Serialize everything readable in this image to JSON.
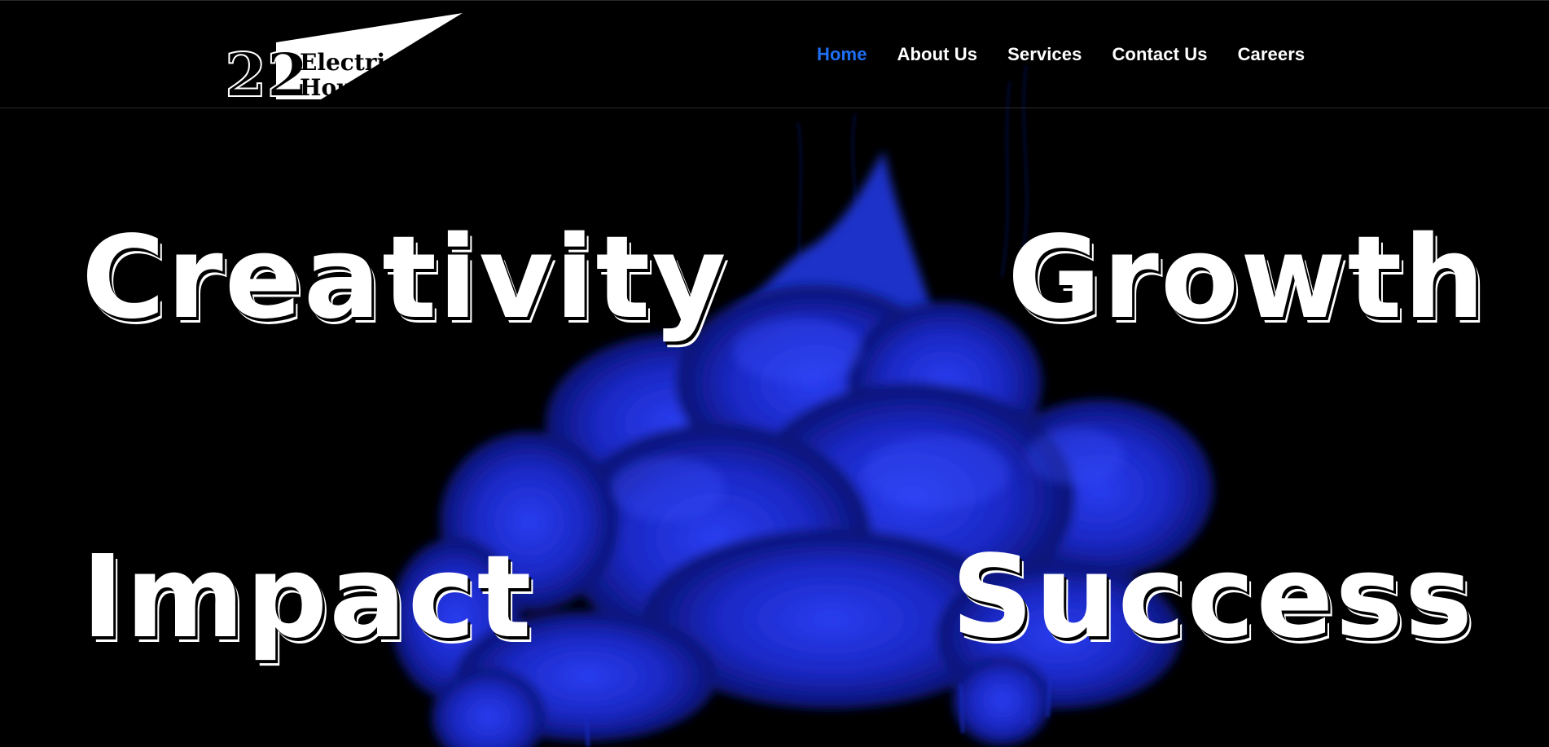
{
  "brand": {
    "logo_number": "22",
    "logo_line1": "Electric",
    "logo_line2": "House"
  },
  "nav": {
    "items": [
      {
        "label": "Home",
        "active": true
      },
      {
        "label": "About Us",
        "active": false
      },
      {
        "label": "Services",
        "active": false
      },
      {
        "label": "Contact Us",
        "active": false
      },
      {
        "label": "Careers",
        "active": false
      }
    ]
  },
  "hero": {
    "words": [
      "Creativity",
      "Growth",
      "Impact",
      "Success"
    ]
  },
  "colors": {
    "background": "#000000",
    "accent": "#1e6ff2",
    "smoke": "#1a2fd0",
    "text": "#ffffff"
  }
}
